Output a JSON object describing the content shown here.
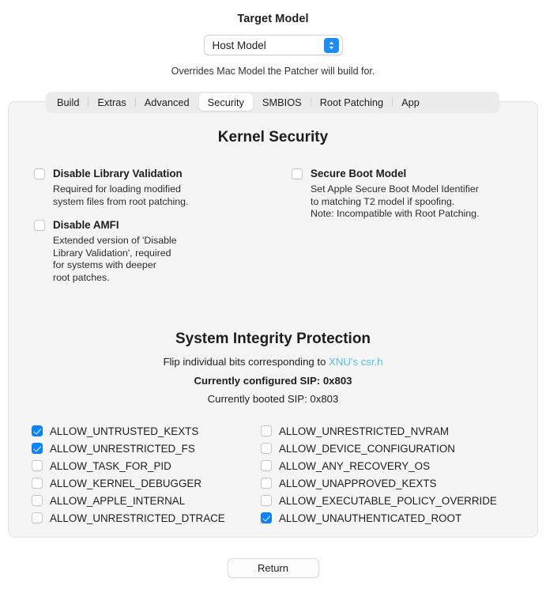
{
  "header": {
    "title": "Target Model",
    "model_select": {
      "value": "Host Model",
      "icon": "updown-chevron-icon"
    },
    "subtitle": "Overrides Mac Model the Patcher will build for."
  },
  "tabs": [
    {
      "label": "Build",
      "selected": false
    },
    {
      "label": "Extras",
      "selected": false
    },
    {
      "label": "Advanced",
      "selected": false
    },
    {
      "label": "Security",
      "selected": true
    },
    {
      "label": "SMBIOS",
      "selected": false
    },
    {
      "label": "Root Patching",
      "selected": false
    },
    {
      "label": "App",
      "selected": false
    }
  ],
  "kernel_security": {
    "title": "Kernel Security",
    "left_options": [
      {
        "label": "Disable Library Validation",
        "checked": false,
        "description": "Required for loading modified\nsystem files from root patching."
      },
      {
        "label": "Disable AMFI",
        "checked": false,
        "description": "Extended version of 'Disable\nLibrary Validation', required\nfor systems with deeper\nroot patches."
      }
    ],
    "right_options": [
      {
        "label": "Secure Boot Model",
        "checked": false,
        "description": "Set Apple Secure Boot Model Identifier\nto matching T2 model if spoofing.\nNote: Incompatible with Root Patching."
      }
    ]
  },
  "sip": {
    "title": "System Integrity Protection",
    "flip_prefix": "Flip individual bits corresponding to ",
    "link_text": "XNU's csr.h",
    "link_color": "#54c3dd",
    "configured_label": "Currently configured SIP: 0x803",
    "booted_label": "Currently booted SIP: 0x803",
    "bits_left": [
      {
        "label": "ALLOW_UNTRUSTED_KEXTS",
        "checked": true
      },
      {
        "label": "ALLOW_UNRESTRICTED_FS",
        "checked": true
      },
      {
        "label": "ALLOW_TASK_FOR_PID",
        "checked": false
      },
      {
        "label": "ALLOW_KERNEL_DEBUGGER",
        "checked": false
      },
      {
        "label": "ALLOW_APPLE_INTERNAL",
        "checked": false
      },
      {
        "label": "ALLOW_UNRESTRICTED_DTRACE",
        "checked": false
      }
    ],
    "bits_right": [
      {
        "label": "ALLOW_UNRESTRICTED_NVRAM",
        "checked": false
      },
      {
        "label": "ALLOW_DEVICE_CONFIGURATION",
        "checked": false
      },
      {
        "label": "ALLOW_ANY_RECOVERY_OS",
        "checked": false
      },
      {
        "label": "ALLOW_UNAPPROVED_KEXTS",
        "checked": false
      },
      {
        "label": "ALLOW_EXECUTABLE_POLICY_OVERRIDE",
        "checked": false
      },
      {
        "label": "ALLOW_UNAUTHENTICATED_ROOT",
        "checked": true
      }
    ]
  },
  "footer": {
    "return_label": "Return"
  },
  "colors": {
    "accent_blue": "#0a84ff",
    "popup_blue": "#1d8cf5",
    "panel_bg": "#f5f5f5",
    "tabbar_bg": "#ececec",
    "link": "#54c3dd"
  }
}
